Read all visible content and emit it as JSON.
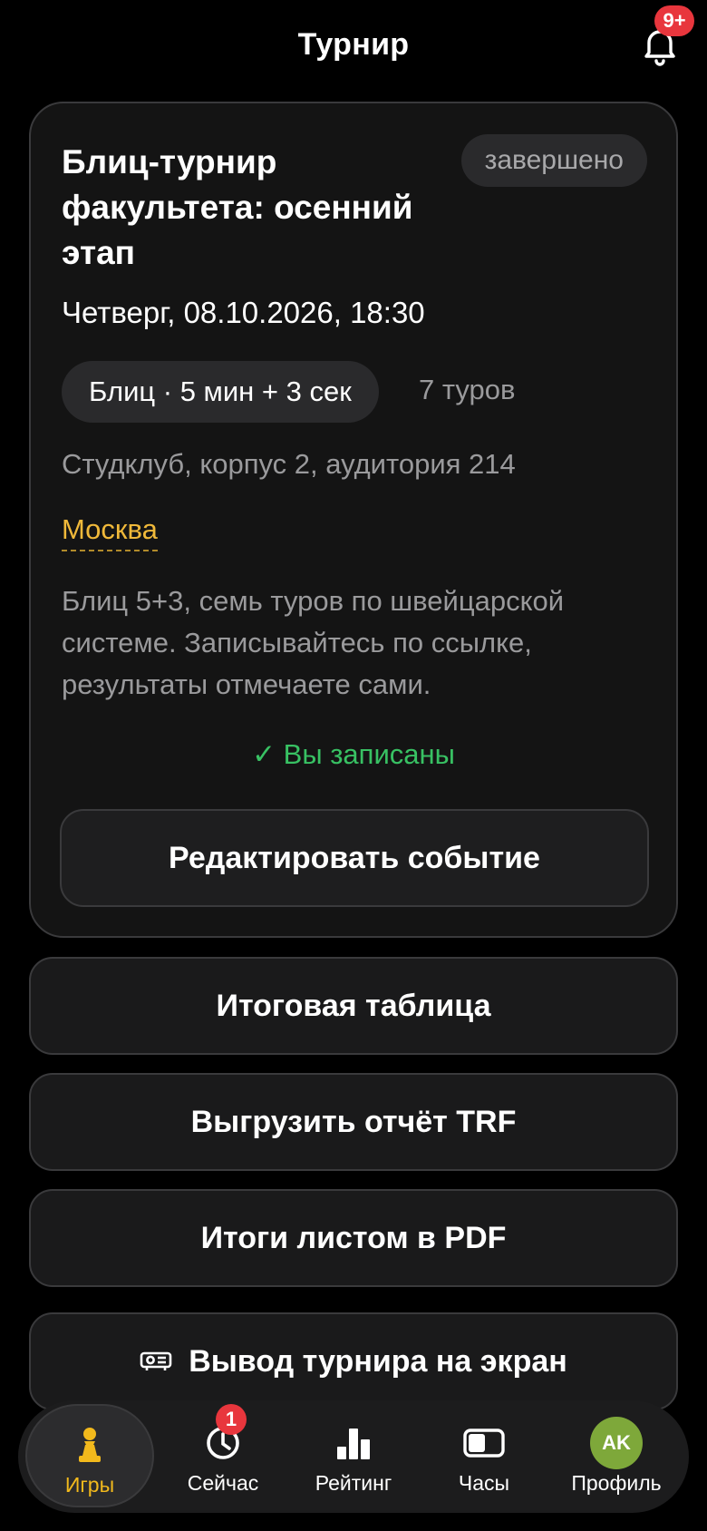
{
  "header": {
    "title": "Турнир",
    "notifications_badge": "9+"
  },
  "event": {
    "title": "Блиц-турнир факультета: осенний этап",
    "status": "завершено",
    "datetime": "Четверг, 08.10.2026, 18:30",
    "format": "Блиц · 5 мин + 3 сек",
    "rounds": "7 туров",
    "venue": "Студклуб, корпус 2, аудитория 214",
    "city": "Москва",
    "description": "Блиц 5+3, семь туров по швейцарской системе. Записывайтесь по ссылке, результаты отмечаете сами.",
    "registered": "✓ Вы записаны",
    "edit_label": "Редактировать событие"
  },
  "actions": {
    "standings": "Итоговая таблица",
    "export_trf": "Выгрузить отчёт TRF",
    "pdf": "Итоги листом в PDF",
    "display": "Вывод турнира на экран"
  },
  "tabbar": {
    "games": "Игры",
    "now": "Сейчас",
    "now_badge": "1",
    "rating": "Рейтинг",
    "clock": "Часы",
    "profile": "Профиль",
    "avatar_initials": "AK"
  },
  "colors": {
    "accent": "#f2b91c",
    "success": "#38c163",
    "badge": "#e8363d"
  }
}
